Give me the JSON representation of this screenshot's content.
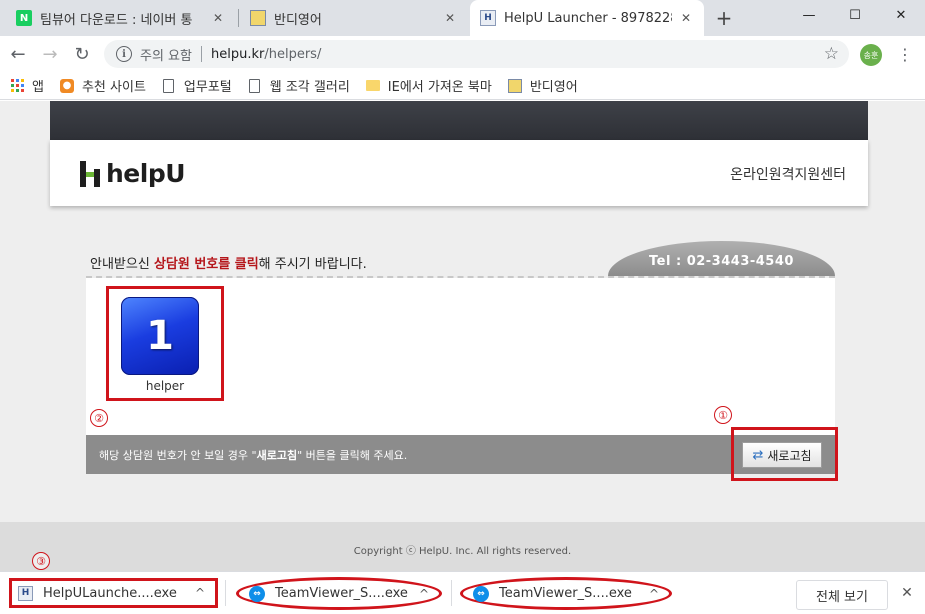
{
  "tabs": [
    {
      "title": "팀뷰어 다운로드 : 네이버 통",
      "favicon": "N",
      "close": "✕"
    },
    {
      "title": "반디영어",
      "close": "✕"
    },
    {
      "title": "HelpU Launcher - 8978228",
      "favicon": "H",
      "close": "✕"
    }
  ],
  "new_tab": "+",
  "window": {
    "minimize": "—",
    "maximize": "☐",
    "close": "✕"
  },
  "address": {
    "info": "i",
    "warning": "주의 요함",
    "host": "helpu.kr",
    "path": "/helpers/",
    "star": "☆"
  },
  "nav": {
    "back": "←",
    "forward": "→",
    "reload": "↻"
  },
  "profile": {
    "label": "송훈"
  },
  "menu": "⋮",
  "bookmarks": [
    {
      "label": "앱",
      "icon": "apps-icon"
    },
    {
      "label": "추천 사이트",
      "icon": "bulb-icon"
    },
    {
      "label": "업무포털",
      "icon": "page-icon"
    },
    {
      "label": "웹 조각 갤러리",
      "icon": "page-icon"
    },
    {
      "label": "IE에서 가져온 북마",
      "icon": "folder-icon"
    },
    {
      "label": "반디영어",
      "icon": "bandi-icon"
    }
  ],
  "page": {
    "logo": "helpU",
    "header_right": "온라인원격지원센터",
    "instruction_pre": "안내받으신 ",
    "instruction_highlight": "상담원 번호를 클릭",
    "instruction_post": "해 주시기 바랍니다.",
    "tel": "Tel : 02-3443-4540",
    "helper_number": "1",
    "helper_name": "helper",
    "footer_pre": "해당 상담원 번호가 안 보일 경우 \"",
    "footer_bold": "새로고침",
    "footer_post": "\" 버튼을 클릭해 주세요.",
    "refresh_label": "새로고침",
    "copyright": "Copyright ⓒ HelpU. Inc. All rights reserved."
  },
  "annotations": {
    "one": "①",
    "two": "②",
    "three": "③"
  },
  "downloads": [
    {
      "name": "HelpULaunche....exe",
      "chevron": "^"
    },
    {
      "name": "TeamViewer_S....exe",
      "chevron": "^"
    },
    {
      "name": "TeamViewer_S....exe",
      "chevron": "^"
    }
  ],
  "show_all": "전체 보기",
  "shelf_close": "✕",
  "colors": {
    "accent_red": "#d0141b",
    "highlight_text": "#b5161b",
    "helper_tile": "#1a3de0",
    "logo_green": "#6ab534"
  }
}
